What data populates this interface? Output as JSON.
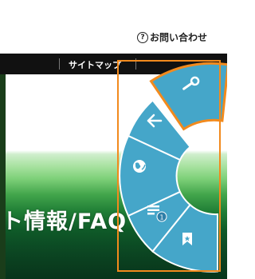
{
  "header": {
    "contact_icon": "question-circle-icon",
    "contact_label": "お問い合わせ"
  },
  "nav": {
    "sitemap_label": "サイトマップ"
  },
  "hero": {
    "text": "ト情報/FAQ"
  },
  "radial_menu": {
    "items": [
      {
        "icon": "wrench-icon",
        "selected": true
      },
      {
        "icon": "back-arrow-icon",
        "selected": false
      },
      {
        "icon": "globe-icon",
        "selected": false
      },
      {
        "icon": "note-list-icon",
        "selected": false,
        "badge": "1"
      },
      {
        "icon": "bookmark-icon",
        "selected": false
      }
    ],
    "colors": {
      "segment": "#45a6c9",
      "segment_border": "#ffffff",
      "selected_border": "#f28a1d",
      "highlight_box": "#f28a1d"
    }
  }
}
